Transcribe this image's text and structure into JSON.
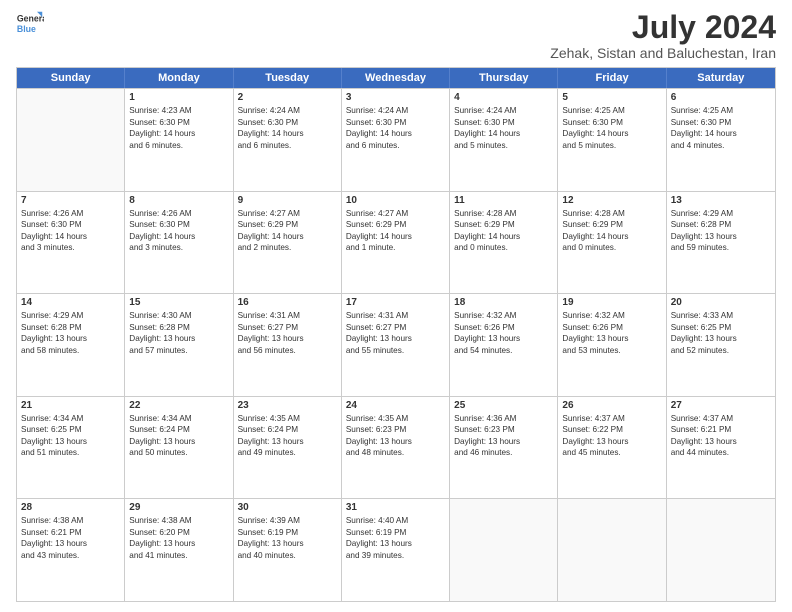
{
  "logo": {
    "line1": "General",
    "line2": "Blue"
  },
  "title": "July 2024",
  "subtitle": "Zehak, Sistan and Baluchestan, Iran",
  "headers": [
    "Sunday",
    "Monday",
    "Tuesday",
    "Wednesday",
    "Thursday",
    "Friday",
    "Saturday"
  ],
  "weeks": [
    [
      {
        "day": "",
        "info": ""
      },
      {
        "day": "1",
        "info": "Sunrise: 4:23 AM\nSunset: 6:30 PM\nDaylight: 14 hours\nand 6 minutes."
      },
      {
        "day": "2",
        "info": "Sunrise: 4:24 AM\nSunset: 6:30 PM\nDaylight: 14 hours\nand 6 minutes."
      },
      {
        "day": "3",
        "info": "Sunrise: 4:24 AM\nSunset: 6:30 PM\nDaylight: 14 hours\nand 6 minutes."
      },
      {
        "day": "4",
        "info": "Sunrise: 4:24 AM\nSunset: 6:30 PM\nDaylight: 14 hours\nand 5 minutes."
      },
      {
        "day": "5",
        "info": "Sunrise: 4:25 AM\nSunset: 6:30 PM\nDaylight: 14 hours\nand 5 minutes."
      },
      {
        "day": "6",
        "info": "Sunrise: 4:25 AM\nSunset: 6:30 PM\nDaylight: 14 hours\nand 4 minutes."
      }
    ],
    [
      {
        "day": "7",
        "info": "Sunrise: 4:26 AM\nSunset: 6:30 PM\nDaylight: 14 hours\nand 3 minutes."
      },
      {
        "day": "8",
        "info": "Sunrise: 4:26 AM\nSunset: 6:30 PM\nDaylight: 14 hours\nand 3 minutes."
      },
      {
        "day": "9",
        "info": "Sunrise: 4:27 AM\nSunset: 6:29 PM\nDaylight: 14 hours\nand 2 minutes."
      },
      {
        "day": "10",
        "info": "Sunrise: 4:27 AM\nSunset: 6:29 PM\nDaylight: 14 hours\nand 1 minute."
      },
      {
        "day": "11",
        "info": "Sunrise: 4:28 AM\nSunset: 6:29 PM\nDaylight: 14 hours\nand 0 minutes."
      },
      {
        "day": "12",
        "info": "Sunrise: 4:28 AM\nSunset: 6:29 PM\nDaylight: 14 hours\nand 0 minutes."
      },
      {
        "day": "13",
        "info": "Sunrise: 4:29 AM\nSunset: 6:28 PM\nDaylight: 13 hours\nand 59 minutes."
      }
    ],
    [
      {
        "day": "14",
        "info": "Sunrise: 4:29 AM\nSunset: 6:28 PM\nDaylight: 13 hours\nand 58 minutes."
      },
      {
        "day": "15",
        "info": "Sunrise: 4:30 AM\nSunset: 6:28 PM\nDaylight: 13 hours\nand 57 minutes."
      },
      {
        "day": "16",
        "info": "Sunrise: 4:31 AM\nSunset: 6:27 PM\nDaylight: 13 hours\nand 56 minutes."
      },
      {
        "day": "17",
        "info": "Sunrise: 4:31 AM\nSunset: 6:27 PM\nDaylight: 13 hours\nand 55 minutes."
      },
      {
        "day": "18",
        "info": "Sunrise: 4:32 AM\nSunset: 6:26 PM\nDaylight: 13 hours\nand 54 minutes."
      },
      {
        "day": "19",
        "info": "Sunrise: 4:32 AM\nSunset: 6:26 PM\nDaylight: 13 hours\nand 53 minutes."
      },
      {
        "day": "20",
        "info": "Sunrise: 4:33 AM\nSunset: 6:25 PM\nDaylight: 13 hours\nand 52 minutes."
      }
    ],
    [
      {
        "day": "21",
        "info": "Sunrise: 4:34 AM\nSunset: 6:25 PM\nDaylight: 13 hours\nand 51 minutes."
      },
      {
        "day": "22",
        "info": "Sunrise: 4:34 AM\nSunset: 6:24 PM\nDaylight: 13 hours\nand 50 minutes."
      },
      {
        "day": "23",
        "info": "Sunrise: 4:35 AM\nSunset: 6:24 PM\nDaylight: 13 hours\nand 49 minutes."
      },
      {
        "day": "24",
        "info": "Sunrise: 4:35 AM\nSunset: 6:23 PM\nDaylight: 13 hours\nand 48 minutes."
      },
      {
        "day": "25",
        "info": "Sunrise: 4:36 AM\nSunset: 6:23 PM\nDaylight: 13 hours\nand 46 minutes."
      },
      {
        "day": "26",
        "info": "Sunrise: 4:37 AM\nSunset: 6:22 PM\nDaylight: 13 hours\nand 45 minutes."
      },
      {
        "day": "27",
        "info": "Sunrise: 4:37 AM\nSunset: 6:21 PM\nDaylight: 13 hours\nand 44 minutes."
      }
    ],
    [
      {
        "day": "28",
        "info": "Sunrise: 4:38 AM\nSunset: 6:21 PM\nDaylight: 13 hours\nand 43 minutes."
      },
      {
        "day": "29",
        "info": "Sunrise: 4:38 AM\nSunset: 6:20 PM\nDaylight: 13 hours\nand 41 minutes."
      },
      {
        "day": "30",
        "info": "Sunrise: 4:39 AM\nSunset: 6:19 PM\nDaylight: 13 hours\nand 40 minutes."
      },
      {
        "day": "31",
        "info": "Sunrise: 4:40 AM\nSunset: 6:19 PM\nDaylight: 13 hours\nand 39 minutes."
      },
      {
        "day": "",
        "info": ""
      },
      {
        "day": "",
        "info": ""
      },
      {
        "day": "",
        "info": ""
      }
    ]
  ]
}
